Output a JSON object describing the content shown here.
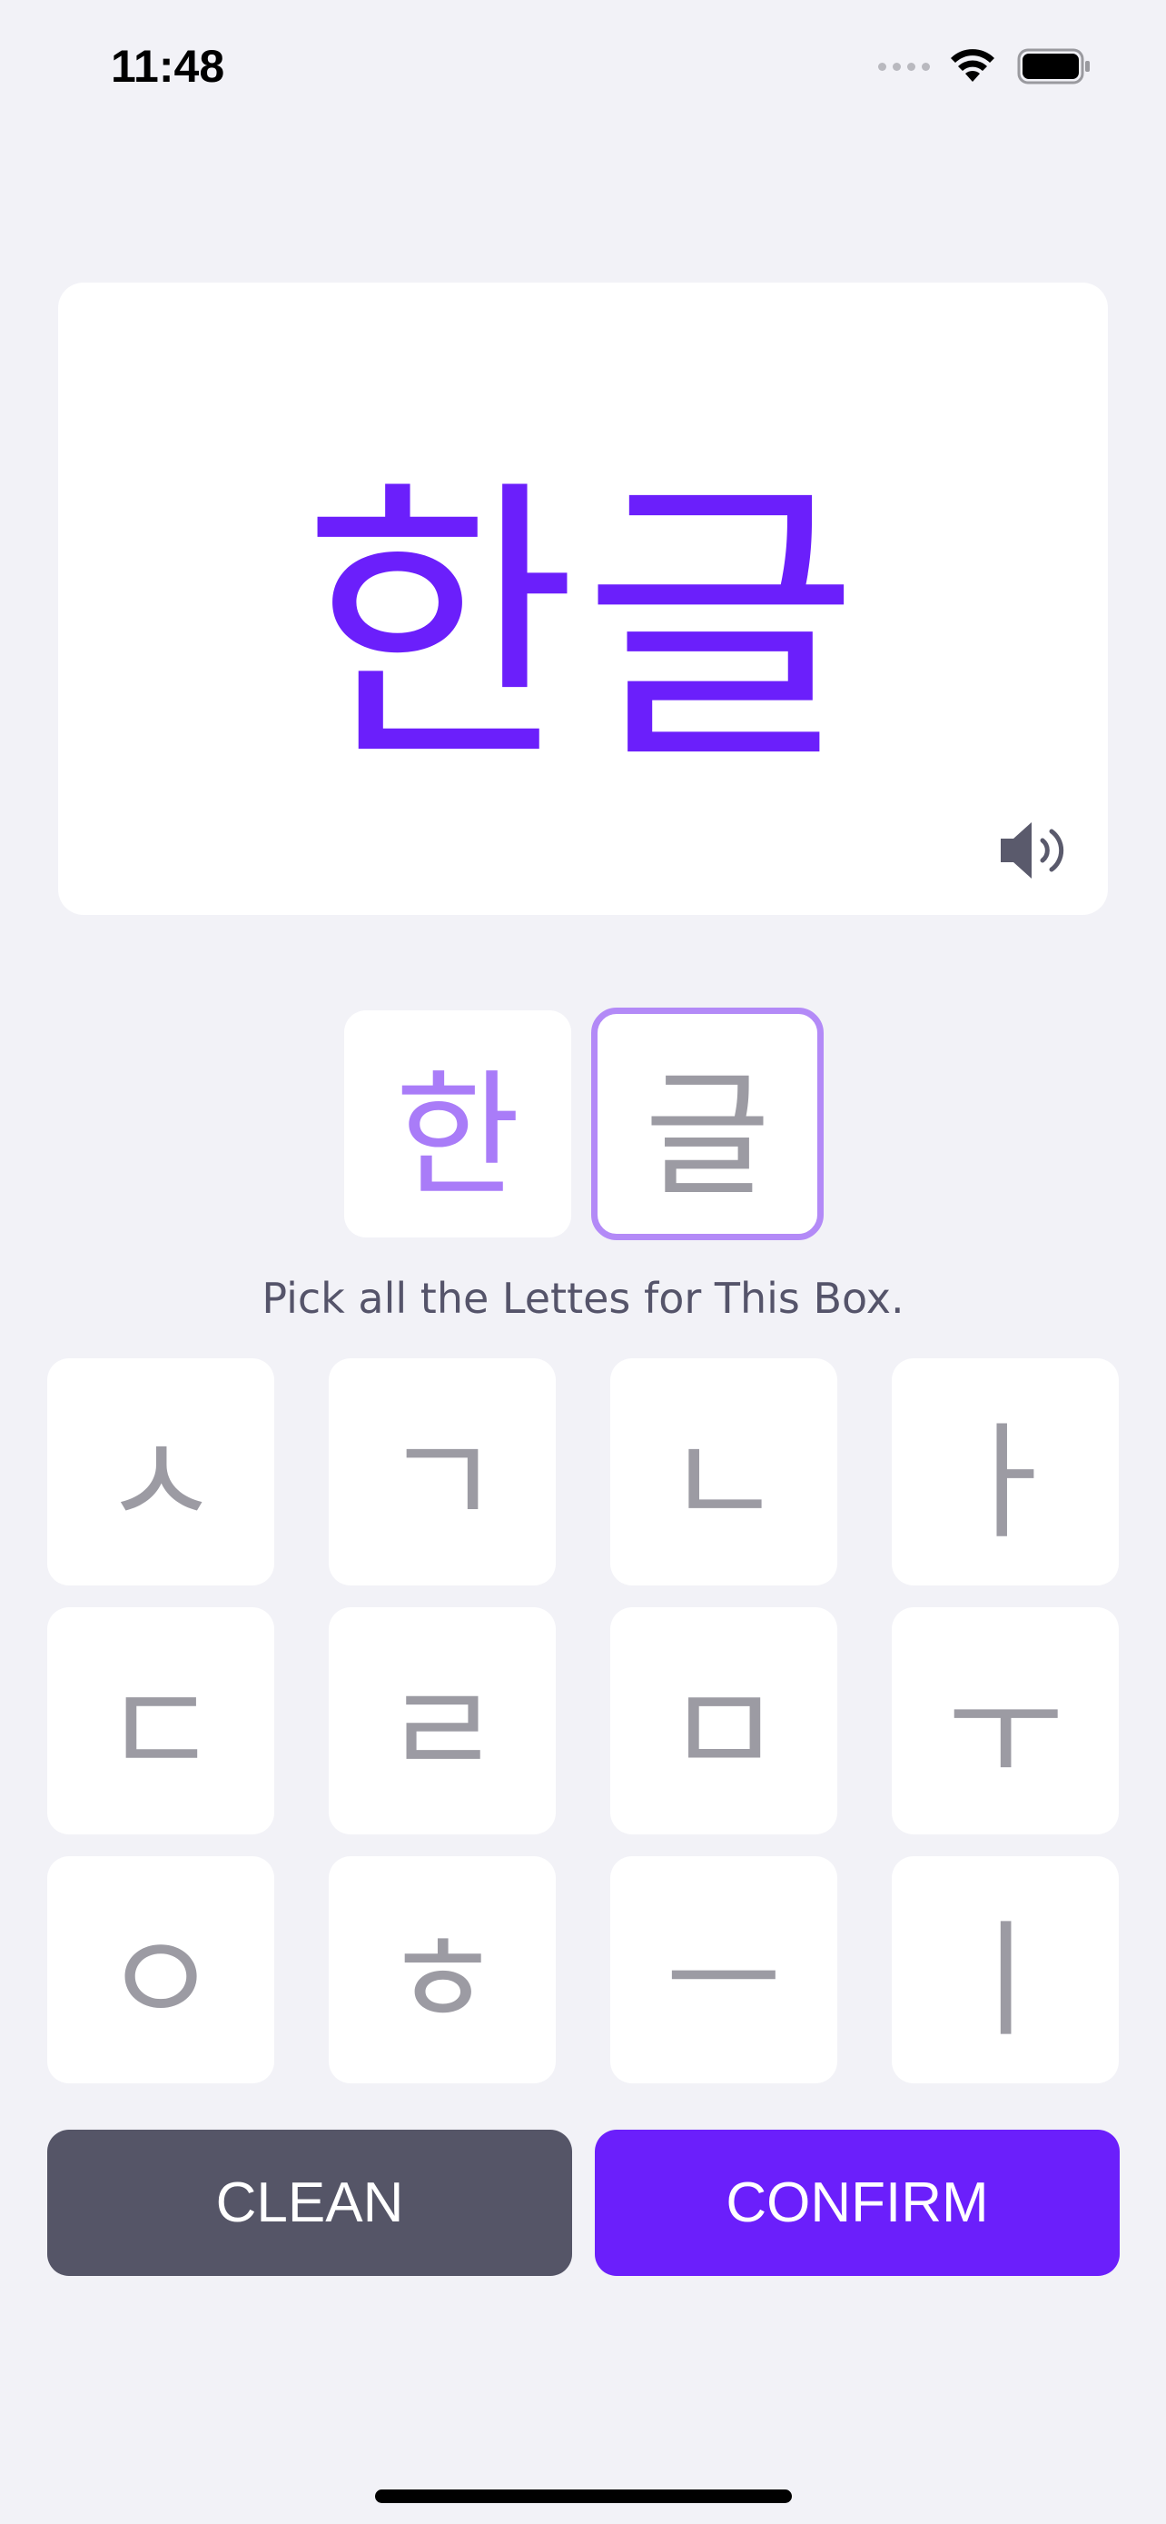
{
  "status_bar": {
    "time": "11:48",
    "icons": [
      "cellular-signal-icon",
      "wifi-icon",
      "battery-icon"
    ]
  },
  "word_card": {
    "word": "한글",
    "speaker_icon": "speaker-volume-icon"
  },
  "syllables": [
    {
      "text": "한",
      "state": "completed"
    },
    {
      "text": "글",
      "state": "active"
    }
  ],
  "instruction": "Pick all the Lettes for This Box.",
  "letters": [
    "ㅅ",
    "ㄱ",
    "ㄴ",
    "ㅏ",
    "ㄷ",
    "ㄹ",
    "ㅁ",
    "ㅜ",
    "ㅇ",
    "ㅎ",
    "ㅡ",
    "ㅣ"
  ],
  "buttons": {
    "clean": "CLEAN",
    "confirm": "CONFIRM"
  },
  "colors": {
    "accent": "#6b1ffb",
    "completed_syllable": "#a97cf8",
    "active_border": "#b38af7",
    "letter": "#9c9ba3",
    "clean_button": "#555567",
    "background": "#f2f2f7"
  }
}
